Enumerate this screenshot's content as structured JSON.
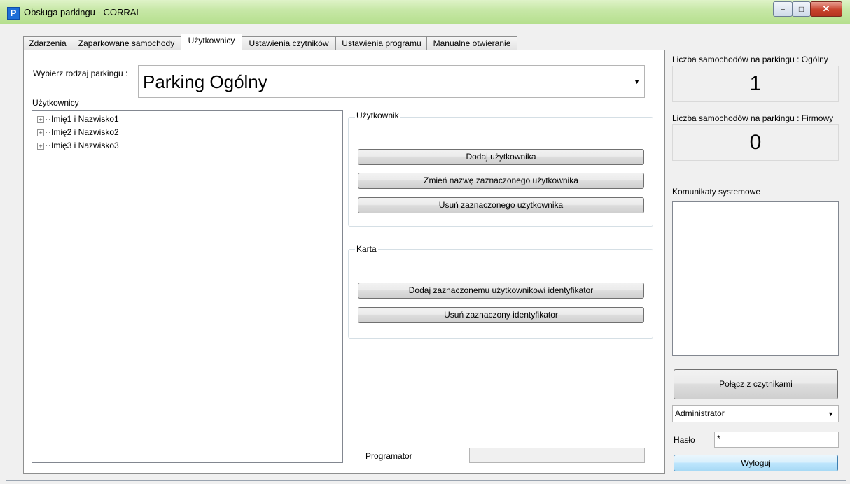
{
  "window": {
    "title": "Obsługa parkingu - CORRAL",
    "icon_letter": "P"
  },
  "window_controls": {
    "minimize": "–",
    "maximize": "□",
    "close": "✕"
  },
  "tabs": [
    {
      "label": "Zdarzenia"
    },
    {
      "label": "Zaparkowane samochody"
    },
    {
      "label": "Użytkownicy",
      "active": true
    },
    {
      "label": "Ustawienia czytników"
    },
    {
      "label": "Ustawienia programu"
    },
    {
      "label": "Manualne otwieranie"
    }
  ],
  "parking_select": {
    "label": "Wybierz rodzaj parkingu :",
    "value": "Parking Ogólny"
  },
  "users_tree": {
    "label": "Użytkownicy",
    "items": [
      "Imię1 i Nazwisko1",
      "Imię2 i Nazwisko2",
      "Imię3 i Nazwisko3"
    ]
  },
  "user_group": {
    "title": "Użytkownik",
    "add_label": "Dodaj użytkownika",
    "rename_label": "Zmień nazwę zaznaczonego użytkownika",
    "remove_label": "Usuń zaznaczonego użytkownika"
  },
  "card_group": {
    "title": "Karta",
    "add_id_label": "Dodaj zaznaczonemu użytkownikowi identyfikator",
    "remove_id_label": "Usuń zaznaczony identyfikator"
  },
  "programator": {
    "label": "Programator",
    "value": ""
  },
  "sidebar": {
    "general_label": "Liczba samochodów na parkingu : Ogólny",
    "general_count": "1",
    "company_label": "Liczba samochodów na parkingu : Firmowy",
    "company_count": "0",
    "messages_label": "Komunikaty systemowe",
    "connect_label": "Połącz z czytnikami",
    "user_value": "Administrator",
    "password_label": "Hasło",
    "password_value": "*",
    "logout_label": "Wyloguj"
  }
}
